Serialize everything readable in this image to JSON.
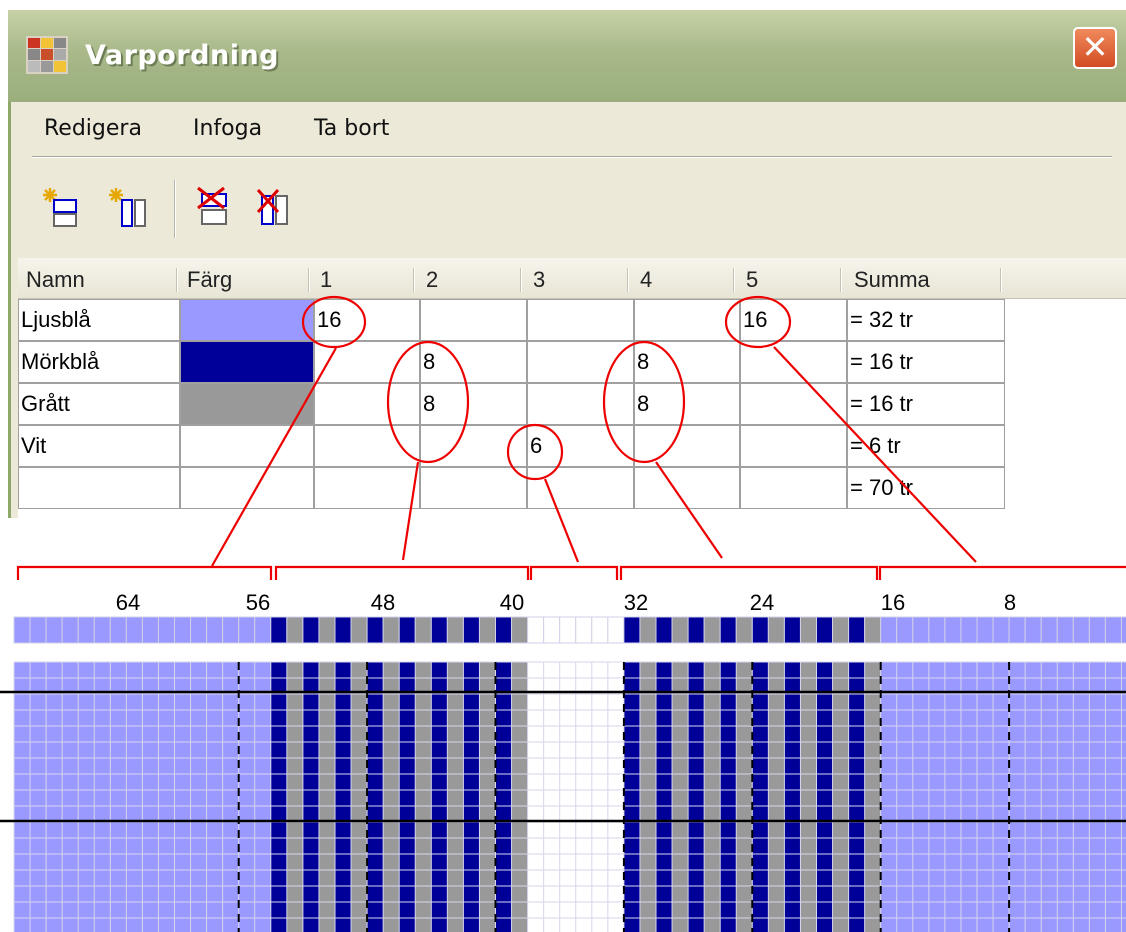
{
  "window": {
    "title": "Varpordning"
  },
  "menu": {
    "items": [
      "Redigera",
      "Infoga",
      "Ta bort"
    ]
  },
  "toolbar": {
    "icons": [
      "insert-row-icon",
      "insert-column-icon",
      "delete-row-icon",
      "delete-column-icon"
    ]
  },
  "grid": {
    "headers": [
      "Namn",
      "Färg",
      "1",
      "2",
      "3",
      "4",
      "5",
      "Summa"
    ],
    "rows": [
      {
        "name": "Ljusblå",
        "color": "#9999ff",
        "cells": [
          "16",
          "",
          "",
          "",
          "16"
        ],
        "sum": "= 32 tr"
      },
      {
        "name": "Mörkblå",
        "color": "#000099",
        "cells": [
          "",
          "8",
          "",
          "8",
          ""
        ],
        "sum": "= 16 tr"
      },
      {
        "name": "Grått",
        "color": "#999999",
        "cells": [
          "",
          "8",
          "",
          "8",
          ""
        ],
        "sum": "= 16 tr"
      },
      {
        "name": "Vit",
        "color": "",
        "cells": [
          "",
          "",
          "6",
          "",
          ""
        ],
        "sum": "= 6 tr"
      },
      {
        "name": "",
        "color": "",
        "cells": [
          "",
          "",
          "",
          "",
          ""
        ],
        "sum": "= 70 tr"
      }
    ]
  },
  "warp": {
    "ticks": [
      "64",
      "56",
      "48",
      "40",
      "32",
      "24",
      "16",
      "8"
    ],
    "colors": {
      "light_blue": "#9999ff",
      "dark_blue": "#000099",
      "gray": "#999999",
      "white": "#ffffff",
      "annotation": "#ee0000"
    }
  }
}
